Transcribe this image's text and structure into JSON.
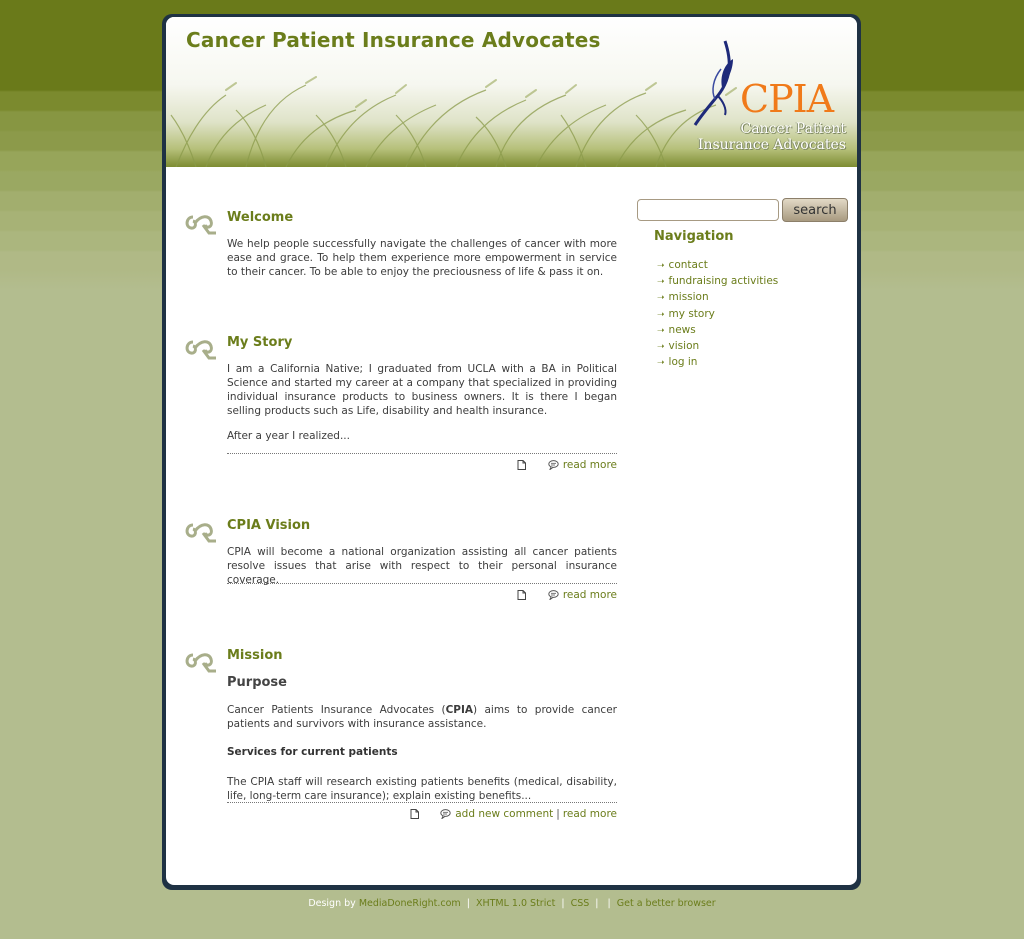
{
  "header": {
    "site_title": "Cancer Patient Insurance Advocates",
    "logo_text": "CPIA",
    "logo_subtitle_line1": "Cancer Patient",
    "logo_subtitle_line2": "Insurance Advocates"
  },
  "posts": [
    {
      "title": "Welcome",
      "body": "We help people successfully navigate the challenges of cancer with more ease and grace. To help them experience more empowerment in service to their cancer. To be able to enjoy the preciousness of life & pass it on."
    },
    {
      "title": "My Story",
      "body": "I am a California Native; I graduated from UCLA with a BA in Political Science and started my career at a company that specialized in providing individual insurance products to business owners. It is there I began selling products such as Life, disability and health insurance.",
      "body2": "After a year I realized...",
      "read_more": "read more"
    },
    {
      "title": "CPIA Vision",
      "body": "CPIA will become a national organization assisting all cancer patients resolve issues that arise with respect to their personal insurance coverage.",
      "read_more": "read more"
    },
    {
      "title": "Mission",
      "subtitle": "Purpose",
      "body_pre": "Cancer Patients Insurance Advocates (",
      "body_bold": "CPIA",
      "body_post": ") aims to provide cancer patients and survivors with insurance assistance.",
      "services_heading": "Services for current patients",
      "body2": "The CPIA staff will research existing patients benefits (medical, disability, life, long-term care insurance); explain existing benefits...",
      "add_comment": "add new comment",
      "separator": "|",
      "read_more": "read more"
    }
  ],
  "sidebar": {
    "search_placeholder": "",
    "search_button": "search",
    "nav_title": "Navigation",
    "nav_items": [
      "contact",
      "fundraising activities",
      "mission",
      "my story",
      "news",
      "vision",
      "log in"
    ]
  },
  "footer": {
    "design_by": "Design by",
    "designer": "MediaDoneRight.com",
    "xhtml": "XHTML 1.0 Strict",
    "css": "CSS",
    "better_browser": "Get a better browser",
    "separator": "|"
  },
  "colors": {
    "accent_green": "#6b7d1b",
    "frame_navy": "#1f3244",
    "logo_orange": "#f07a1a",
    "background": "#b3bd8f"
  },
  "icons": {
    "post_icon": "swirl-ornament-icon",
    "document_icon": "document-icon",
    "comment_icon": "comment-bubble-icon",
    "nav_arrow": "arrow-right-icon"
  }
}
